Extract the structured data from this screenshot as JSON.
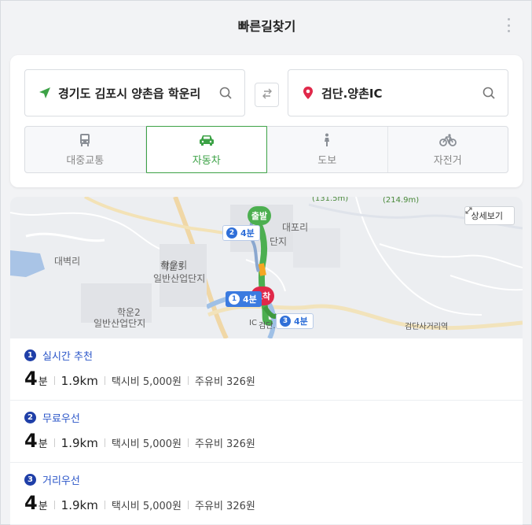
{
  "header": {
    "title": "빠른길찾기"
  },
  "search": {
    "origin_value": "경기도 김포시 양촌읍 학운리",
    "destination_value": "검단.양촌IC"
  },
  "modes": [
    {
      "label": "대중교통",
      "icon": "bus-icon"
    },
    {
      "label": "자동차",
      "icon": "car-icon",
      "active": true
    },
    {
      "label": "도보",
      "icon": "walk-icon"
    },
    {
      "label": "자전거",
      "icon": "bicycle-icon"
    }
  ],
  "map": {
    "detail_label": "상세보기",
    "labels": {
      "daebyeok": "대벽리",
      "hakun3": "학운3",
      "hakun3_sub": "일반산업단지",
      "hakun_ri": "학운리",
      "hakun2": "학운2",
      "hakun2_sub": "일반산업단지",
      "daepo": "대포리",
      "dangi": "단지",
      "geomdan": "검단.",
      "ic": "IC",
      "geomdan_sa": "검단사거리역",
      "road1": "(131.5m)",
      "road2": "(214.9m)"
    },
    "markers": {
      "start": "출발",
      "end": "도착"
    },
    "badges": [
      {
        "num": "2",
        "label": "4분"
      },
      {
        "num": "1",
        "label": "4분"
      },
      {
        "num": "3",
        "label": "4분"
      }
    ]
  },
  "routes": [
    {
      "num": "1",
      "name": "실시간 추천",
      "time": "4",
      "time_unit": "분",
      "distance": "1.9km",
      "taxi": "택시비 5,000원",
      "fuel": "주유비 326원"
    },
    {
      "num": "2",
      "name": "무료우선",
      "time": "4",
      "time_unit": "분",
      "distance": "1.9km",
      "taxi": "택시비 5,000원",
      "fuel": "주유비 326원"
    },
    {
      "num": "3",
      "name": "거리우선",
      "time": "4",
      "time_unit": "분",
      "distance": "1.9km",
      "taxi": "택시비 5,000원",
      "fuel": "주유비 326원"
    }
  ],
  "colors": {
    "accent_green": "#3ca246",
    "route_blue": "#2a55c8",
    "dest_red": "#e0294a"
  }
}
